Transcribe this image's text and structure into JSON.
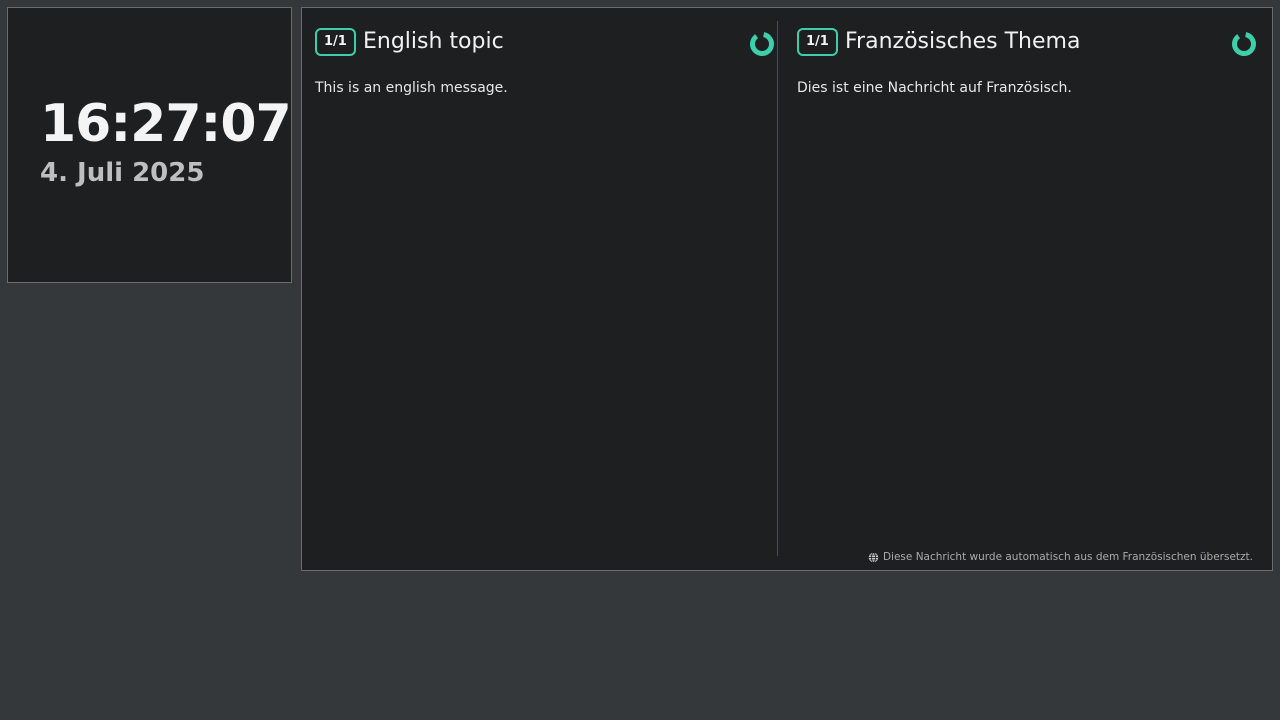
{
  "clock": {
    "time": "16:27:07",
    "date": "4. Juli 2025"
  },
  "messages": [
    {
      "badge": "1/1",
      "topic": "English topic",
      "body": "This is an english message.",
      "timer_icon": "progress-ring-icon"
    },
    {
      "badge": "1/1",
      "topic": "Französisches Thema",
      "body": "Dies ist eine Nachricht auf Französisch.",
      "timer_icon": "progress-ring-icon"
    }
  ],
  "translation_note": {
    "icon": "globe-icon",
    "text": "Diese Nachricht wurde automatisch aus dem Französischen übersetzt."
  },
  "colors": {
    "accent": "#3ccfa9",
    "background": "#35383b",
    "panel": "#1e1f21"
  }
}
